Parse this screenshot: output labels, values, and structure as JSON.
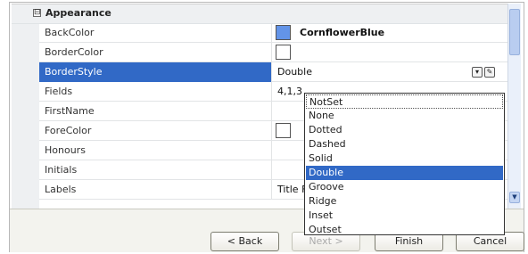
{
  "category": {
    "toggle": "⊟",
    "label": "Appearance"
  },
  "properties": [
    {
      "name": "BackColor",
      "value": "CornflowerBlue",
      "swatch": "#6394e8"
    },
    {
      "name": "BorderColor",
      "value": "",
      "swatch": "#ffffff"
    },
    {
      "name": "BorderStyle",
      "value": "Double"
    },
    {
      "name": "Fields",
      "value": "4,1,3"
    },
    {
      "name": "FirstName",
      "value": ""
    },
    {
      "name": "ForeColor",
      "value": "",
      "swatch": "#ffffff"
    },
    {
      "name": "Honours",
      "value": ""
    },
    {
      "name": "Initials",
      "value": ""
    },
    {
      "name": "Labels",
      "value": "Title F"
    }
  ],
  "dropdown": {
    "options": [
      "NotSet",
      "None",
      "Dotted",
      "Dashed",
      "Solid",
      "Double",
      "Groove",
      "Ridge",
      "Inset",
      "Outset"
    ],
    "selected": "Double"
  },
  "icons": {
    "dropdown_button": "combo-dropdown-icon",
    "edit_button": "pencil-edit-icon",
    "scroll_down": "scroll-down-arrow-icon"
  },
  "buttons": {
    "back": "< Back",
    "next": "Next >",
    "finish": "Finish",
    "cancel": "Cancel"
  },
  "colors": {
    "selection": "#3169c6",
    "cornflower": "#6394e8"
  }
}
